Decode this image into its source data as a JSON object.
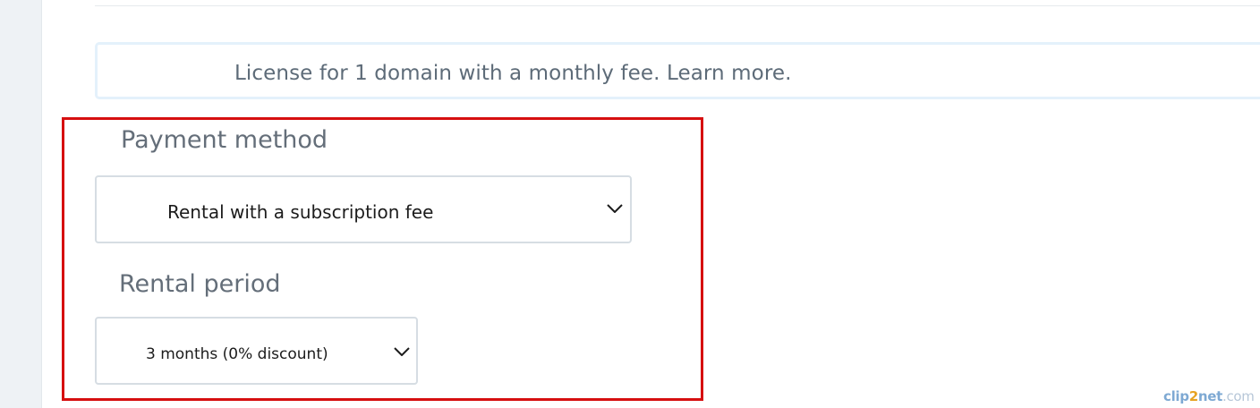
{
  "notice": {
    "text": "License for 1 domain with a monthly fee. Learn more."
  },
  "payment_method": {
    "label": "Payment method",
    "selected": "Rental with a subscription fee",
    "icon": "chevron-down-icon"
  },
  "rental_period": {
    "label": "Rental period",
    "selected": "3 months (0% discount)",
    "icon": "chevron-down-icon"
  },
  "highlight": {
    "color": "#d60f10"
  },
  "watermark": {
    "prefix": "clip",
    "middle": "2",
    "suffix": "net",
    "domain": ".com"
  }
}
